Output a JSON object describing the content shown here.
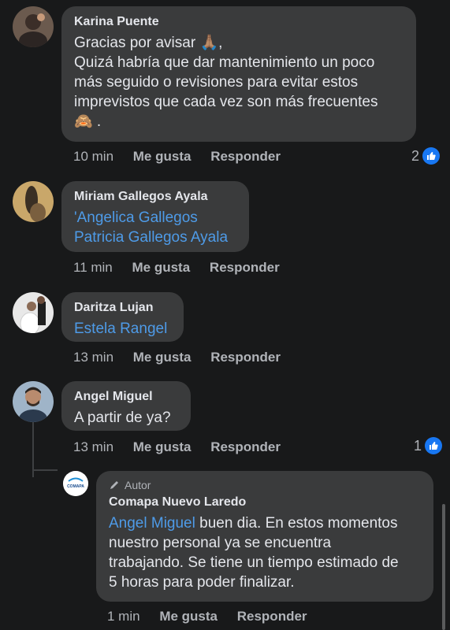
{
  "comments": [
    {
      "author": "Karina Puente",
      "lines": [
        "Gracias por avisar 🙏🏽,",
        "Quizá habría que dar mantenimiento un poco",
        "más seguido o revisiones para evitar estos",
        "imprevistos que cada vez son más frecuentes",
        "🙈 ."
      ],
      "time": "10 min",
      "like": "Me gusta",
      "reply": "Responder",
      "reactions": "2"
    },
    {
      "author": "Miriam Gallegos Ayala",
      "mentions": [
        "'Angelica Gallegos",
        "Patricia Gallegos Ayala"
      ],
      "time": "11 min",
      "like": "Me gusta",
      "reply": "Responder"
    },
    {
      "author": "Daritza Lujan",
      "mentions": [
        "Estela Rangel"
      ],
      "time": "13 min",
      "like": "Me gusta",
      "reply": "Responder"
    },
    {
      "author": "Angel Miguel",
      "text": "A partir de ya?",
      "time": "13 min",
      "like": "Me gusta",
      "reply": "Responder",
      "reactions": "1"
    }
  ],
  "reply": {
    "badge": "Autor",
    "author": "Comapa Nuevo Laredo",
    "logo_text": "COMAPA",
    "mention": "Angel Miguel",
    "line1_rest": " buen dia. En estos momentos",
    "line2": "nuestro personal ya se encuentra",
    "line3": "trabajando. Se tiene un tiempo estimado de",
    "line4": "5 horas para poder finalizar.",
    "time": "1 min",
    "like": "Me gusta",
    "reply": "Responder"
  },
  "colors": {
    "background": "#18191a",
    "bubble": "#3a3b3c",
    "link": "#4e9be8",
    "like_blue": "#1877f2"
  }
}
